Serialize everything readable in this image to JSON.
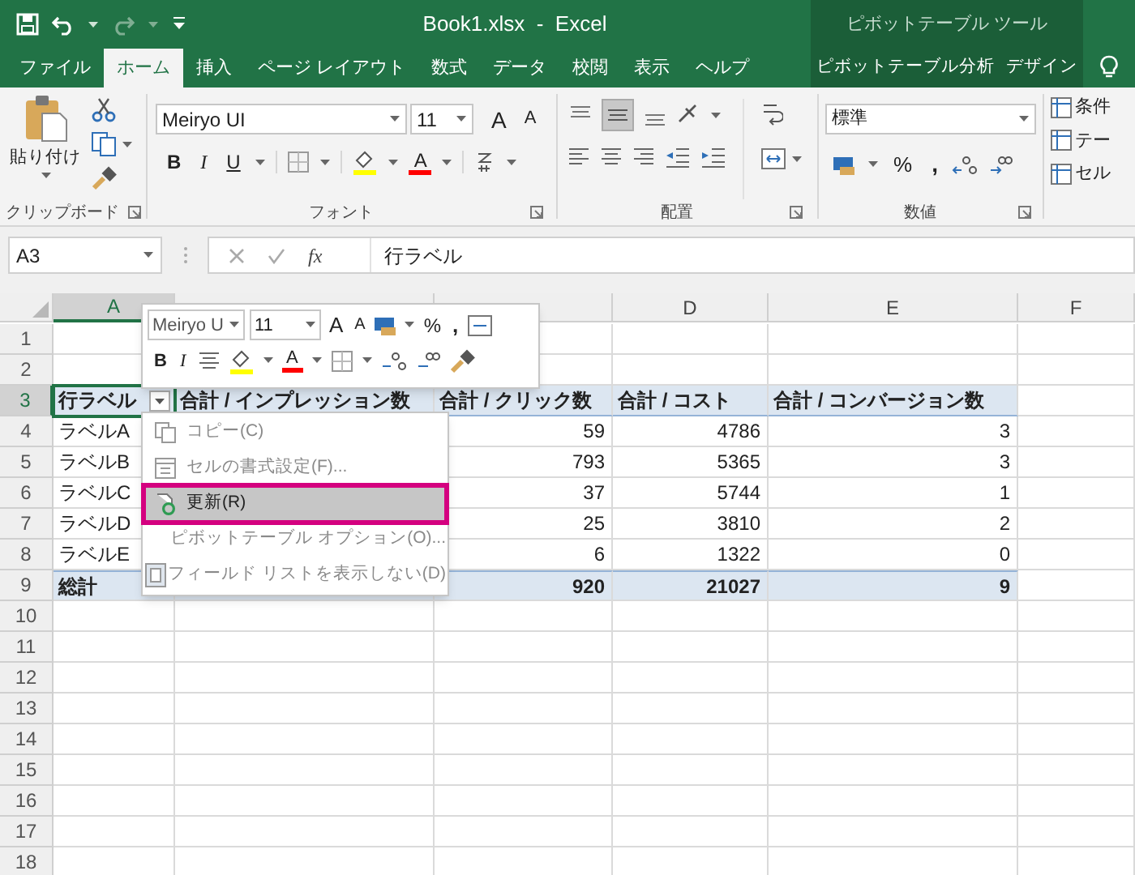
{
  "title_bar": {
    "title": "Book1.xlsx  -  Excel",
    "context_title": "ピボットテーブル ツール"
  },
  "tabs": [
    {
      "label": "ファイル",
      "selected": false,
      "contextual": false
    },
    {
      "label": "ホーム",
      "selected": true,
      "contextual": false
    },
    {
      "label": "挿入",
      "selected": false,
      "contextual": false
    },
    {
      "label": "ページ レイアウト",
      "selected": false,
      "contextual": false
    },
    {
      "label": "数式",
      "selected": false,
      "contextual": false
    },
    {
      "label": "データ",
      "selected": false,
      "contextual": false
    },
    {
      "label": "校閲",
      "selected": false,
      "contextual": false
    },
    {
      "label": "表示",
      "selected": false,
      "contextual": false
    },
    {
      "label": "ヘルプ",
      "selected": false,
      "contextual": false
    },
    {
      "label": "ピボットテーブル分析",
      "selected": false,
      "contextual": true
    },
    {
      "label": "デザイン",
      "selected": false,
      "contextual": true
    }
  ],
  "ribbon": {
    "paste_label": "貼り付け",
    "font_name": "Meiryo UI",
    "font_size": "11",
    "grow_glyphs": [
      "A",
      "A"
    ],
    "style_buttons": [
      "B",
      "I",
      "U"
    ],
    "font_color_glyph": "A",
    "number_format": "標準",
    "percent": "%",
    "comma": ",",
    "styles_items": [
      "条件",
      "テー",
      "セル"
    ],
    "group_labels": [
      "クリップボード",
      "フォント",
      "配置",
      "数値"
    ]
  },
  "formula_bar": {
    "name_box": "A3",
    "function_label": "fx",
    "content": "行ラベル"
  },
  "sheet": {
    "columns": [
      {
        "letter": "A",
        "selected": true
      },
      {
        "selected": false
      },
      {
        "selected": false
      },
      {
        "letter": "D",
        "selected": false
      },
      {
        "letter": "E",
        "selected": false
      },
      {
        "letter": "F",
        "selected": false
      }
    ],
    "rows": [
      {
        "number": "1",
        "selected": false,
        "kind": "empty"
      },
      {
        "number": "2",
        "selected": false,
        "kind": "empty"
      },
      {
        "number": "3",
        "selected": true,
        "kind": "pivot_header",
        "cells": {
          "A": "行ラベル",
          "B": "合計 / インプレッション数",
          "C": "合計 / クリック数",
          "D": "合計 / コスト",
          "E": "合計 / コンバージョン数"
        }
      },
      {
        "number": "4",
        "selected": false,
        "kind": "data",
        "cells": {
          "A": "ラベルA",
          "C": "59",
          "D": "4786",
          "E": "3"
        }
      },
      {
        "number": "5",
        "selected": false,
        "kind": "data",
        "cells": {
          "A": "ラベルB",
          "C": "793",
          "D": "5365",
          "E": "3"
        }
      },
      {
        "number": "6",
        "selected": false,
        "kind": "data",
        "cells": {
          "A": "ラベルC",
          "C": "37",
          "D": "5744",
          "E": "1"
        }
      },
      {
        "number": "7",
        "selected": false,
        "kind": "data",
        "cells": {
          "A": "ラベルD",
          "C": "25",
          "D": "3810",
          "E": "2"
        }
      },
      {
        "number": "8",
        "selected": false,
        "kind": "data",
        "cells": {
          "A": "ラベルE",
          "C": "6",
          "D": "1322",
          "E": "0"
        }
      },
      {
        "number": "9",
        "selected": false,
        "kind": "total",
        "cells": {
          "A": "総計",
          "C": "920",
          "D": "21027",
          "E": "9"
        }
      },
      {
        "number": "10",
        "selected": false,
        "kind": "empty"
      },
      {
        "number": "11",
        "selected": false,
        "kind": "empty"
      },
      {
        "number": "12",
        "selected": false,
        "kind": "empty"
      },
      {
        "number": "13",
        "selected": false,
        "kind": "empty"
      },
      {
        "number": "14",
        "selected": false,
        "kind": "empty"
      },
      {
        "number": "15",
        "selected": false,
        "kind": "empty"
      },
      {
        "number": "16",
        "selected": false,
        "kind": "empty"
      },
      {
        "number": "17",
        "selected": false,
        "kind": "empty"
      },
      {
        "number": "18",
        "selected": false,
        "kind": "empty"
      }
    ]
  },
  "mini_toolbar": {
    "font_name": "Meiryo U",
    "font_size": "11",
    "grow_glyphs": [
      "A",
      "A"
    ],
    "percent": "%",
    "comma": ",",
    "style_buttons": [
      "B",
      "I"
    ],
    "font_color_glyph": "A"
  },
  "context_menu": [
    {
      "label": "コピー(C)",
      "disabled": true,
      "highlighted": false
    },
    {
      "label": "セルの書式設定(F)...",
      "disabled": true,
      "highlighted": false
    },
    {
      "label": "更新(R)",
      "disabled": false,
      "highlighted": true
    },
    {
      "label": "ピボットテーブル オプション(O)...",
      "disabled": true,
      "highlighted": false
    },
    {
      "label": "フィールド リストを表示しない(D)",
      "disabled": true,
      "highlighted": false
    }
  ]
}
